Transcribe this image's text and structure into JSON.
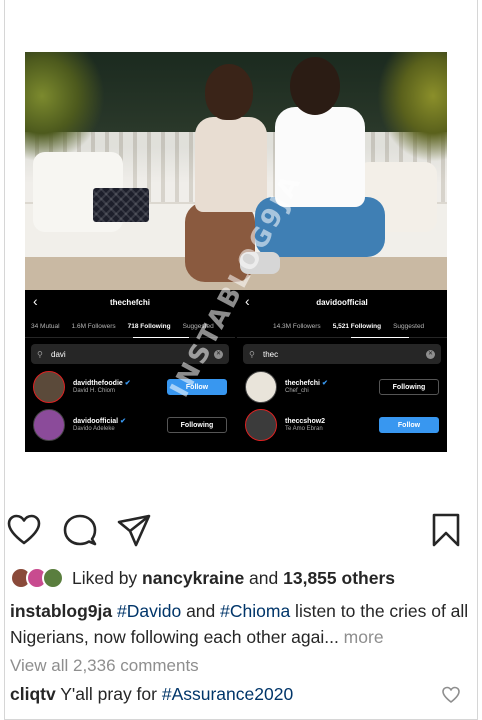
{
  "left_panel": {
    "username": "thechefchi",
    "tabs": [
      "34 Mutual",
      "1.6M Followers",
      "718 Following",
      "Suggested"
    ],
    "active_tab": 2,
    "search_value": "davi",
    "rows": [
      {
        "handle": "davidthefoodie",
        "name": "David H. Chiom",
        "button": "Follow",
        "style": "follow"
      },
      {
        "handle": "davidoofficial",
        "name": "Davido Adeleke",
        "button": "Following",
        "style": "following"
      }
    ]
  },
  "right_panel": {
    "username": "davidoofficial",
    "tabs": [
      "14.3M Followers",
      "5,521 Following",
      "Suggested"
    ],
    "active_tab": 1,
    "search_value": "thec",
    "rows": [
      {
        "handle": "thechefchi",
        "name": "Chef_chi",
        "button": "Following",
        "style": "following"
      },
      {
        "handle": "theccshow2",
        "name": "Te Amo Ebran",
        "button": "Follow",
        "style": "follow"
      }
    ]
  },
  "watermark": "INSTABLOG9JA",
  "likes": {
    "prefix": "Liked by ",
    "user": "nancykraine",
    "middle": " and ",
    "count": "13,855 others"
  },
  "caption": {
    "author": "instablog9ja",
    "tag1": "#Davido",
    "text1": " and ",
    "tag2": "#Chioma",
    "text2": " listen to the cries of all Nigerians, now following each other agai...",
    "more": " more"
  },
  "view_all_comments": "View all 2,336 comments",
  "comment": {
    "author": "cliqtv",
    "text": " Y'all pray for ",
    "tag": "#Assurance2020"
  },
  "colors": {
    "link_blue": "#003569",
    "follow_blue": "#3897f0",
    "muted": "#8e8e8e"
  }
}
